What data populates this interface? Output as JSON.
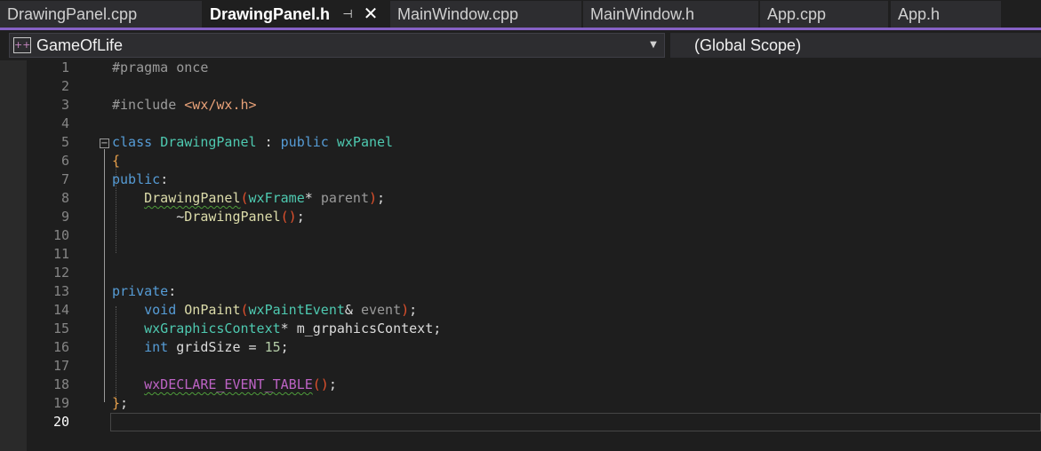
{
  "tabs": [
    {
      "label": "DrawingPanel.cpp",
      "active": false
    },
    {
      "label": "DrawingPanel.h",
      "active": true
    },
    {
      "label": "MainWindow.cpp",
      "active": false
    },
    {
      "label": "MainWindow.h",
      "active": false
    },
    {
      "label": "App.cpp",
      "active": false
    },
    {
      "label": "App.h",
      "active": false
    }
  ],
  "tab_icons": {
    "pin": "pin-icon",
    "close": "close-icon"
  },
  "navbar": {
    "project": "GameOfLife",
    "scope": "(Global Scope)"
  },
  "editor": {
    "current_line": 20,
    "line_numbers": [
      "1",
      "2",
      "3",
      "4",
      "5",
      "6",
      "7",
      "8",
      "9",
      "10",
      "11",
      "12",
      "13",
      "14",
      "15",
      "16",
      "17",
      "18",
      "19",
      "20"
    ],
    "lines": [
      [
        {
          "t": "#pragma once",
          "c": "pre"
        }
      ],
      [],
      [
        {
          "t": "#include ",
          "c": "pre"
        },
        {
          "t": "<wx/wx.h>",
          "c": "str"
        }
      ],
      [],
      [
        {
          "t": "class",
          "c": "kw"
        },
        {
          "t": " ",
          "c": "plain"
        },
        {
          "t": "DrawingPanel",
          "c": "type"
        },
        {
          "t": " : ",
          "c": "plain"
        },
        {
          "t": "public",
          "c": "kw"
        },
        {
          "t": " ",
          "c": "plain"
        },
        {
          "t": "wxPanel",
          "c": "type"
        }
      ],
      [
        {
          "t": "{",
          "c": "brace"
        }
      ],
      [
        {
          "t": "public",
          "c": "kw"
        },
        {
          "t": ":",
          "c": "plain"
        }
      ],
      [
        {
          "t": "    ",
          "c": "plain"
        },
        {
          "t": "DrawingPanel",
          "c": "func",
          "squiggle": true
        },
        {
          "t": "(",
          "c": "paren"
        },
        {
          "t": "wxFrame",
          "c": "type"
        },
        {
          "t": "* ",
          "c": "plain"
        },
        {
          "t": "parent",
          "c": "param"
        },
        {
          "t": ")",
          "c": "paren"
        },
        {
          "t": ";",
          "c": "plain"
        }
      ],
      [
        {
          "t": "        ~",
          "c": "plain"
        },
        {
          "t": "DrawingPanel",
          "c": "func"
        },
        {
          "t": "()",
          "c": "paren"
        },
        {
          "t": ";",
          "c": "plain"
        }
      ],
      [],
      [],
      [],
      [
        {
          "t": "private",
          "c": "kw"
        },
        {
          "t": ":",
          "c": "plain"
        }
      ],
      [
        {
          "t": "    ",
          "c": "plain"
        },
        {
          "t": "void",
          "c": "kw"
        },
        {
          "t": " ",
          "c": "plain"
        },
        {
          "t": "OnPaint",
          "c": "func"
        },
        {
          "t": "(",
          "c": "paren"
        },
        {
          "t": "wxPaintEvent",
          "c": "type"
        },
        {
          "t": "& ",
          "c": "plain"
        },
        {
          "t": "event",
          "c": "param"
        },
        {
          "t": ")",
          "c": "paren"
        },
        {
          "t": ";",
          "c": "plain"
        }
      ],
      [
        {
          "t": "    ",
          "c": "plain"
        },
        {
          "t": "wxGraphicsContext",
          "c": "type"
        },
        {
          "t": "* m_grpahicsContext;",
          "c": "plain"
        }
      ],
      [
        {
          "t": "    ",
          "c": "plain"
        },
        {
          "t": "int",
          "c": "kw"
        },
        {
          "t": " gridSize = ",
          "c": "plain"
        },
        {
          "t": "15",
          "c": "num"
        },
        {
          "t": ";",
          "c": "plain"
        }
      ],
      [],
      [
        {
          "t": "    ",
          "c": "plain"
        },
        {
          "t": "wxDECLARE_EVENT_TABLE",
          "c": "macro",
          "squiggle": true
        },
        {
          "t": "()",
          "c": "paren"
        },
        {
          "t": ";",
          "c": "plain"
        }
      ],
      [
        {
          "t": "}",
          "c": "brace"
        },
        {
          "t": ";",
          "c": "plain"
        }
      ],
      []
    ]
  }
}
